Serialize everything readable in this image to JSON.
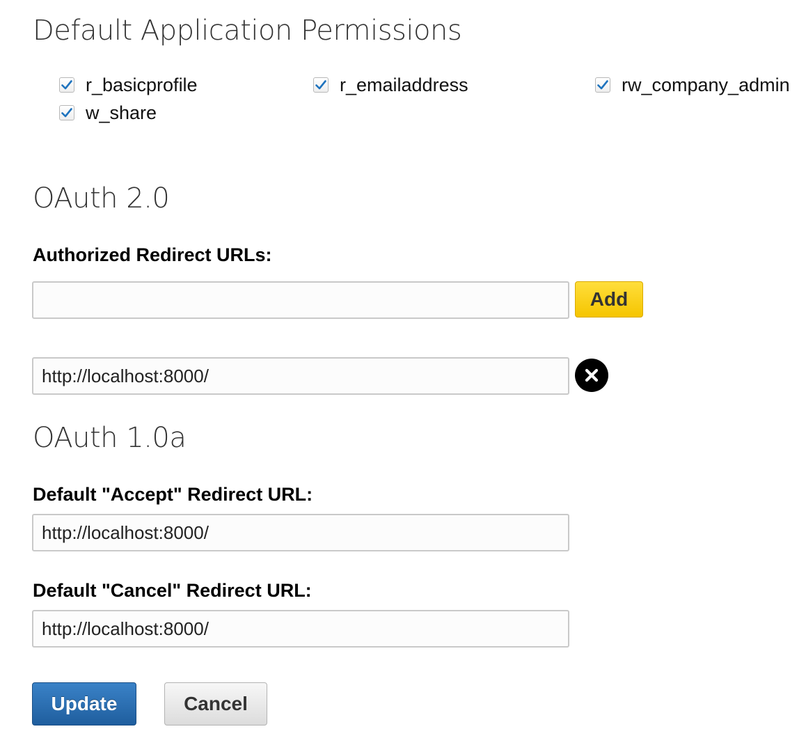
{
  "permissions_section": {
    "title": "Default Application Permissions",
    "items": [
      {
        "label": "r_basicprofile",
        "checked": true
      },
      {
        "label": "r_emailaddress",
        "checked": true
      },
      {
        "label": "rw_company_admin",
        "checked": true
      },
      {
        "label": "w_share",
        "checked": true
      }
    ]
  },
  "oauth2": {
    "title": "OAuth 2.0",
    "redirect_label": "Authorized Redirect URLs:",
    "new_url_value": "",
    "add_label": "Add",
    "urls": [
      {
        "value": "http://localhost:8000/",
        "remove_icon": "close-circle-icon"
      }
    ]
  },
  "oauth1": {
    "title": "OAuth 1.0a",
    "accept_label": "Default \"Accept\" Redirect URL:",
    "accept_value": "http://localhost:8000/",
    "cancel_label": "Default \"Cancel\" Redirect URL:",
    "cancel_value": "http://localhost:8000/"
  },
  "actions": {
    "update_label": "Update",
    "cancel_label": "Cancel"
  },
  "colors": {
    "check": "#1e73be",
    "add_button": "#f5c500",
    "update_button": "#2a6db2"
  }
}
